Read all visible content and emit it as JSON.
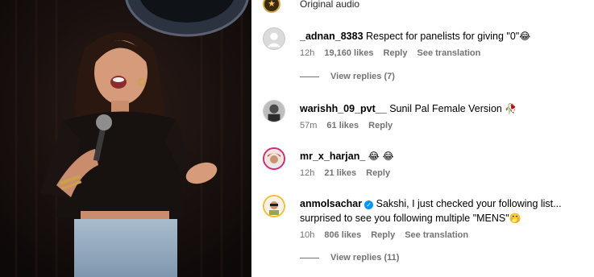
{
  "audio": {
    "label": "Original audio"
  },
  "comments": [
    {
      "username": "_adnan_8383",
      "text": "Respect for panelists for giving \"0\"",
      "emoji": "😂",
      "time": "12h",
      "likes": "19,160 likes",
      "reply": "Reply",
      "translation": "See translation",
      "replies": "View replies (7)"
    },
    {
      "username": "warishh_09_pvt__",
      "text": "Sunil Pal Female Version",
      "emoji": "🥀",
      "time": "57m",
      "likes": "61 likes",
      "reply": "Reply"
    },
    {
      "username": "mr_x_harjan_",
      "text": "",
      "emoji": "😂 😂",
      "time": "12h",
      "likes": "21 likes",
      "reply": "Reply"
    },
    {
      "username": "anmolsachar",
      "text": "Sakshi, I just checked your following list... surprised to see you following multiple \"MENS\"",
      "emoji": "🤭",
      "time": "10h",
      "likes": "806 likes",
      "reply": "Reply",
      "translation": "See translation",
      "replies": "View replies (11)"
    }
  ],
  "icons": {
    "verified": "verified-badge-icon",
    "default_avatar": "default-avatar-icon"
  },
  "colors": {
    "link_blue": "#0095f6",
    "muted": "#737373",
    "story_ring": "#d62976"
  }
}
